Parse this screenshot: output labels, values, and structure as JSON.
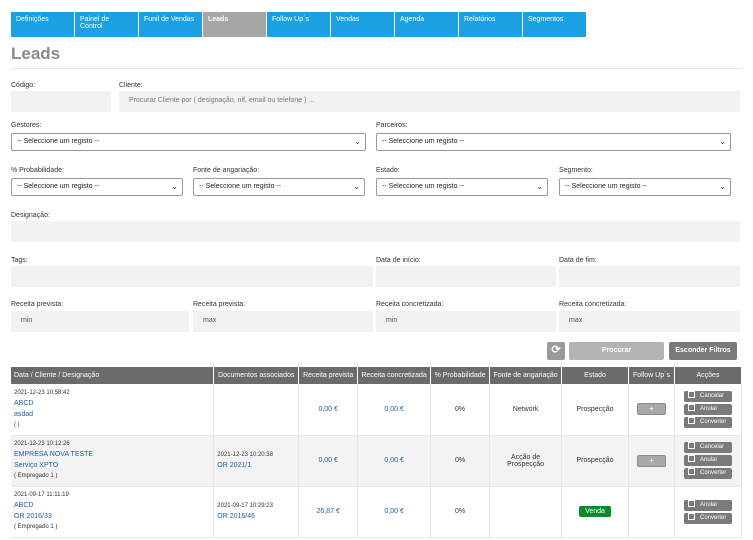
{
  "nav": {
    "tabs": [
      {
        "label": "Definições",
        "active": false
      },
      {
        "label": "Painel de Control",
        "active": false
      },
      {
        "label": "Funil de Vendas",
        "active": false
      },
      {
        "label": "Leads",
        "active": true
      },
      {
        "label": "Follow Up´s",
        "active": false
      },
      {
        "label": "Vendas",
        "active": false
      },
      {
        "label": "Agenda",
        "active": false
      },
      {
        "label": "Relatórios",
        "active": false
      },
      {
        "label": "Segmentos",
        "active": false
      }
    ]
  },
  "page": {
    "title": "Leads"
  },
  "filters": {
    "codigo_label": "Código:",
    "codigo_value": "",
    "cliente_label": "Cliente:",
    "cliente_placeholder": "Procurar Cliente por ( designação, nif, email ou telefone ) ...",
    "gestores_label": "Gestores:",
    "gestores_value": "-- Seleccione um registo --",
    "parceiros_label": "Parceiros:",
    "parceiros_value": "-- Seleccione um registo --",
    "probabilidade_label": "% Probabilidade:",
    "probabilidade_value": "-- Seleccione um registo --",
    "fonte_label": "Fonte de angariação:",
    "fonte_value": "-- Seleccione um registo --",
    "estado_label": "Estado:",
    "estado_value": "-- Seleccione um registo --",
    "segmento_label": "Segmento:",
    "segmento_value": "-- Seleccione um registo --",
    "designacao_label": "Designação:",
    "tags_label": "Tags:",
    "data_inicio_label": "Data de início:",
    "data_fim_label": "Data de fim:",
    "receita_prevista_min_label": "Receita prevista:",
    "receita_prevista_min_placeholder": "min",
    "receita_prevista_max_label": "Receita prevista:",
    "receita_prevista_max_placeholder": "max",
    "receita_concretizada_min_label": "Receita concretizada:",
    "receita_concretizada_min_placeholder": "min",
    "receita_concretizada_max_label": "Receita concretizada:",
    "receita_concretizada_max_placeholder": "max"
  },
  "buttons": {
    "refresh_icon": "⟳",
    "search": "Procurar",
    "hide_filters": "Esconder Filtros"
  },
  "table": {
    "headers": [
      "Data / Cliente / Designação",
      "Documentos associados",
      "Receita prevista",
      "Receita concretizada",
      "% Probabilidade",
      "Fonte de angariação",
      "Estado",
      "Follow Up´s",
      "Acções"
    ],
    "rows": [
      {
        "date": "2021-12-23 10:58:42",
        "client": "ABCD",
        "designation": "asdad",
        "extra": "( )",
        "doc_date": "",
        "doc_ref": "",
        "receita_prevista": "0,00 €",
        "receita_concretizada": "0,00 €",
        "probabilidade": "0%",
        "fonte": "Network",
        "estado": "Prospecção",
        "followup": "+",
        "actions": [
          "Cancelar",
          "Anular",
          "Converter"
        ]
      },
      {
        "date": "2021-12-23 10:12:26",
        "client": "EMPRESA NOVA TESTE",
        "designation": "Serviço XPTO",
        "extra": "( Empregado 1 )",
        "doc_date": "2021-12-23 10:20:38",
        "doc_ref": "OR 2021/1",
        "receita_prevista": "0,00 €",
        "receita_concretizada": "0,00 €",
        "probabilidade": "0%",
        "fonte": "Acção de Prospecção",
        "estado": "Prospecção",
        "followup": "+",
        "actions": [
          "Cancelar",
          "Anular",
          "Converter"
        ]
      },
      {
        "date": "2021-09-17 11:11:19",
        "client": "ABCD",
        "designation": "OR 2016/33",
        "extra": "( Empregado 1 )",
        "doc_date": "2021-09-17 10:29:23",
        "doc_ref": "OR 2016/46",
        "receita_prevista": "26,87 €",
        "receita_concretizada": "0,00 €",
        "probabilidade": "0%",
        "fonte": "",
        "estado": "Venda",
        "followup": "",
        "actions": [
          "Anular",
          "Converter"
        ]
      }
    ]
  },
  "colors": {
    "nav": "#1ba1e2",
    "nav_active": "#a6a6a6",
    "header": "#6b6b6b",
    "venda": "#0a8a2a",
    "link": "#1f5fa8"
  }
}
